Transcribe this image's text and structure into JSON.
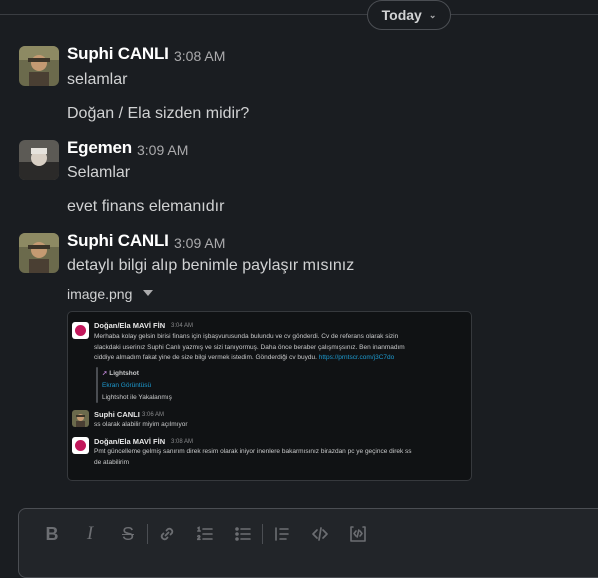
{
  "date_divider": {
    "label": "Today"
  },
  "messages": [
    {
      "author": "Suphi CANLI",
      "time": "3:08 AM",
      "lines": [
        "selamlar",
        "Doğan / Ela sizden midir?"
      ]
    },
    {
      "author": "Egemen",
      "time": "3:09 AM",
      "lines": [
        "Selamlar",
        "evet finans elemanıdır"
      ]
    },
    {
      "author": "Suphi CANLI",
      "time": "3:09 AM",
      "lines": [
        "detaylı bilgi alıp benimle paylaşır mısınız"
      ]
    }
  ],
  "attachment": {
    "file_name": "image.png",
    "preview": {
      "messages": [
        {
          "author": "Doğan/Ela MAVİ FİN",
          "time": "3:04 AM",
          "lines": [
            "Merhaba kolay gelsin birisi finans için işbaşvurusunda bulundu ve cv gönderdi. Cv de  referans olarak sizin",
            "slackdaki userinız Suphi Canlı  yazmış ve sizi tanıyormuş. Daha önce beraber çalışmışsınız. Ben inanmadım",
            "ciddiye almadım fakat yine de size bilgi vermek istedim. Gönderdiği cv buydu."
          ],
          "link": "https://prntscr.com/j3C7do",
          "attachment": {
            "title": "Lightshot",
            "link_text": "Ekran Görüntüsü",
            "footer": "Lightshot ile Yakalanmış"
          }
        },
        {
          "author": "Suphi CANLI",
          "time": "3:06 AM",
          "lines": [
            "ss olarak alabilir miyim açılmıyor"
          ]
        },
        {
          "author": "Doğan/Ela MAVİ FİN",
          "time": "3:08 AM",
          "lines": [
            "Pmt güncelleme gelmiş sanırım direk resim olarak iniyor inenlere bakarmısınız birazdan pc ye geçince direk ss",
            "de atabilirim"
          ]
        }
      ]
    }
  },
  "composer": {
    "toolbar": [
      "bold-icon",
      "italic-icon",
      "strikethrough-icon",
      "link-icon",
      "ordered-list-icon",
      "bulleted-list-icon",
      "blockquote-icon",
      "code-icon",
      "code-block-icon"
    ]
  },
  "colors": {
    "background": "#1a1d21",
    "link": "#1d9bd1",
    "preview_avatar": "#c2185b"
  }
}
